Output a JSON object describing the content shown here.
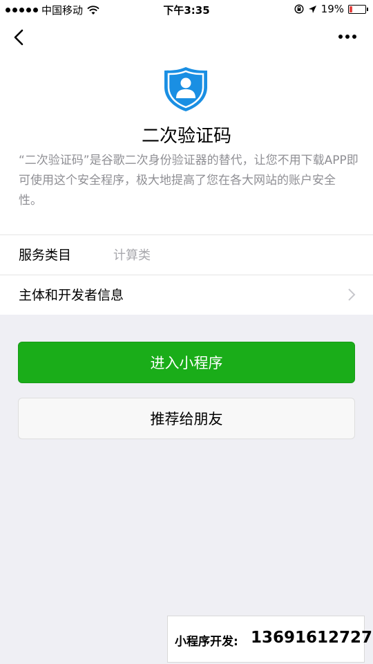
{
  "status_bar": {
    "carrier": "中国移动",
    "time": "下午3:35",
    "battery_percent": "19%",
    "battery_level": 0.19,
    "battery_color": "#e64340"
  },
  "nav": {
    "back_icon": "chevron-left-icon",
    "more_icon": "more-dots-icon"
  },
  "app": {
    "icon": "shield-user-icon",
    "icon_color": "#1a8fe3",
    "name": "二次验证码",
    "description": "“二次验证码”是谷歌二次身份验证器的替代，让您不用下载APP即可使用这个安全程序，极大地提高了您在各大网站的账户安全性。"
  },
  "info_rows": {
    "service_category_label": "服务类目",
    "service_category_value": "计算类",
    "developer_info_label": "主体和开发者信息"
  },
  "buttons": {
    "enter_label": "进入小程序",
    "enter_color": "#1aad19",
    "share_label": "推荐给朋友"
  },
  "watermark": {
    "label": "小程序开发:",
    "phone": "13691612727"
  }
}
